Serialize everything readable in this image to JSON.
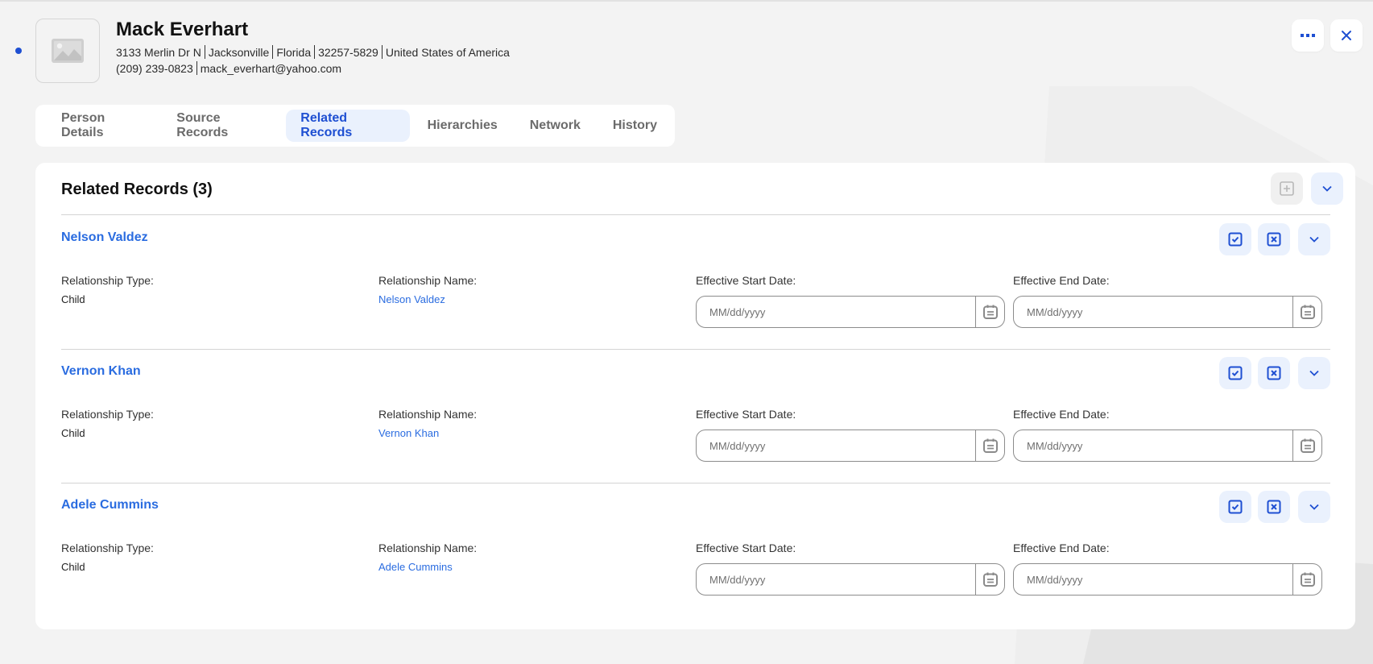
{
  "header": {
    "status_color": "#1e4fd2",
    "name": "Mack Everhart",
    "address_parts": [
      "3133 Merlin Dr N",
      "Jacksonville",
      "Florida",
      "32257-5829",
      "United States of America"
    ],
    "contact_parts": [
      "(209) 239-0823",
      "mack_everhart@yahoo.com"
    ],
    "more_icon": "more-horizontal-icon",
    "close_icon": "close-icon"
  },
  "tabs": [
    {
      "label": "Person Details",
      "active": false
    },
    {
      "label": "Source Records",
      "active": false
    },
    {
      "label": "Related Records",
      "active": true
    },
    {
      "label": "Hierarchies",
      "active": false
    },
    {
      "label": "Network",
      "active": false
    },
    {
      "label": "History",
      "active": false
    }
  ],
  "panel": {
    "title": "Related Records (3)",
    "add_icon": "add-square-icon",
    "expand_icon": "chevron-down-icon"
  },
  "labels": {
    "relationship_type": "Relationship Type:",
    "relationship_name": "Relationship Name:",
    "start_date": "Effective Start Date:",
    "end_date": "Effective End Date:",
    "date_placeholder": "MM/dd/yyyy"
  },
  "records": [
    {
      "title": "Nelson Valdez",
      "relationship_type": "Child",
      "relationship_name": "Nelson Valdez",
      "start_date": "",
      "end_date": ""
    },
    {
      "title": "Vernon Khan",
      "relationship_type": "Child",
      "relationship_name": "Vernon Khan",
      "start_date": "",
      "end_date": ""
    },
    {
      "title": "Adele Cummins",
      "relationship_type": "Child",
      "relationship_name": "Adele Cummins",
      "start_date": "",
      "end_date": ""
    }
  ],
  "colors": {
    "accent": "#1e4fd2",
    "link": "#2a6ce0",
    "active_tab_bg": "#eaf1fd",
    "background": "#f3f3f3"
  }
}
